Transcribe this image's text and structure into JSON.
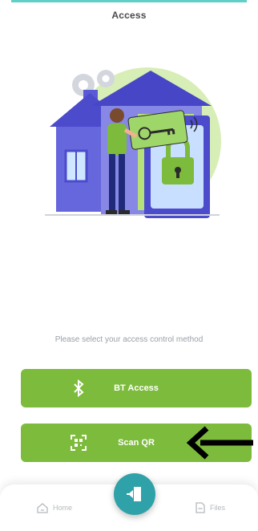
{
  "header": {
    "title": "Access"
  },
  "main": {
    "prompt": "Please select your access control method",
    "options": [
      {
        "label": "BT Access",
        "icon": "bluetooth-icon"
      },
      {
        "label": "Scan QR",
        "icon": "qr-scan-icon"
      }
    ]
  },
  "bottom_nav": {
    "items": [
      {
        "label": "Home",
        "icon": "home-icon"
      },
      {
        "label": "Files",
        "icon": "file-icon"
      }
    ],
    "center_button_icon": "door-exit-icon"
  },
  "colors": {
    "accent_green": "#7dbb3d",
    "teal": "#2ea2a8",
    "house_blue": "#5a5ad6",
    "text_gray": "#9aa1a8"
  }
}
